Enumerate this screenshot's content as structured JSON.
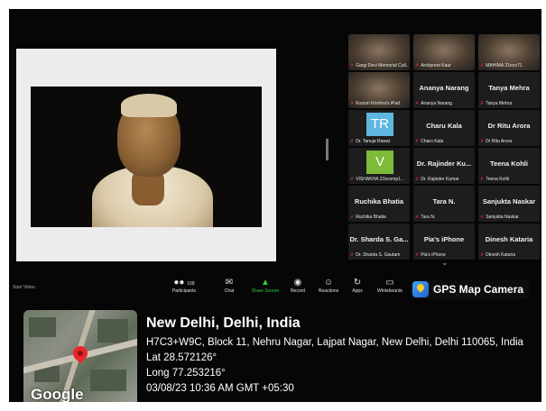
{
  "gallery": {
    "tiles": [
      {
        "name": "",
        "label": "Gargi Devi Memorial Coll...",
        "kind": "video"
      },
      {
        "name": "",
        "label": "Arshpreet Kaur",
        "kind": "video"
      },
      {
        "name": "",
        "label": "MAHIMA 21eco71",
        "kind": "video"
      },
      {
        "name": "",
        "label": "Kusum Krishna's iPad",
        "kind": "video"
      },
      {
        "name": "Ananya Narang",
        "label": "Ananya Narang",
        "kind": "name"
      },
      {
        "name": "Tanya Mehra",
        "label": "Tanya Mehra",
        "kind": "name"
      },
      {
        "name": "",
        "label": "Dr. Tanuja Rawal",
        "kind": "avatar",
        "avatar": "TR",
        "color": "#5db7e0"
      },
      {
        "name": "Charu Kala",
        "label": "Charu Kala",
        "kind": "name"
      },
      {
        "name": "Dr Ritu Arora",
        "label": "Dr Ritu Arora",
        "kind": "name"
      },
      {
        "name": "",
        "label": "VISHAKHA 21bcomp1...",
        "kind": "avatar",
        "avatar": "V",
        "color": "#7dbb39"
      },
      {
        "name": "Dr. Rajinder Ku...",
        "label": "Dr. Rajinder Kumar",
        "kind": "name"
      },
      {
        "name": "Teena Kohli",
        "label": "Teena Kohli",
        "kind": "name"
      },
      {
        "name": "Ruchika Bhatia",
        "label": "Ruchika Bhatia",
        "kind": "name"
      },
      {
        "name": "Tara N.",
        "label": "Tara N.",
        "kind": "name"
      },
      {
        "name": "Sanjukta Naskar",
        "label": "Sanjukta Naskar",
        "kind": "name"
      },
      {
        "name": "Dr. Sharda S. Ga...",
        "label": "Dr. Sharda S. Gautam",
        "kind": "name"
      },
      {
        "name": "Pia's iPhone",
        "label": "Pia's iPhone",
        "kind": "name"
      },
      {
        "name": "Dinesh Kataria",
        "label": "Dinesh Kataria",
        "kind": "name"
      }
    ]
  },
  "toolbar": {
    "start_video": "Start Video",
    "participants": "Participants",
    "participants_count": "109",
    "chat": "Chat",
    "share_screen": "Share Screen",
    "record": "Record",
    "reactions": "Reactions",
    "apps": "Apps",
    "whiteboards": "Whiteboards"
  },
  "gps": {
    "badge": "GPS Map Camera",
    "map_logo": "Google",
    "city": "New Delhi, Delhi, India",
    "address": "H7C3+W9C, Block 11, Nehru Nagar, Lajpat Nagar, New Delhi, Delhi 110065, India",
    "lat": "Lat 28.572126°",
    "long": "Long 77.253216°",
    "datetime": "03/08/23 10:36 AM GMT +05:30"
  }
}
